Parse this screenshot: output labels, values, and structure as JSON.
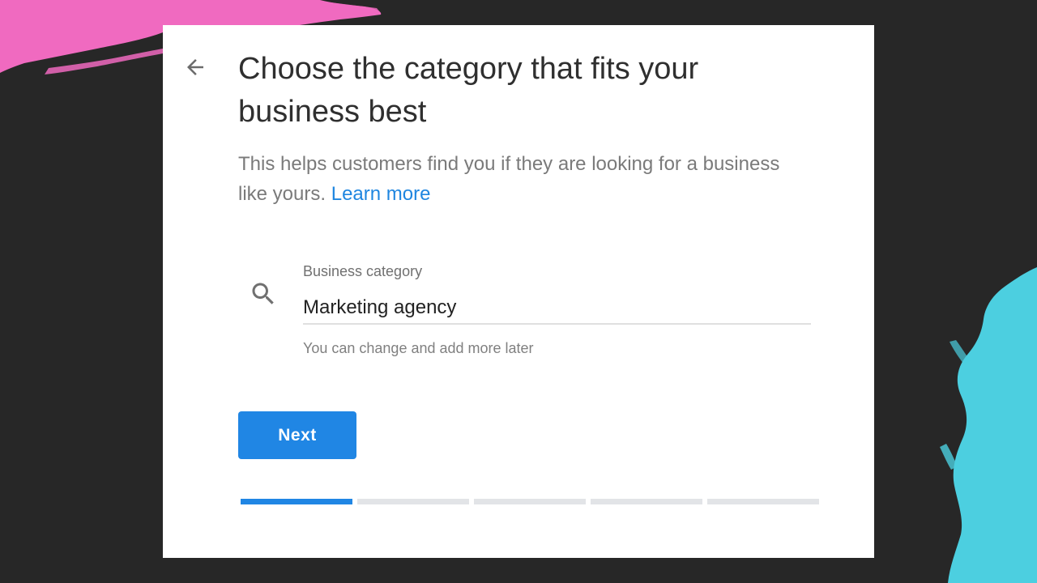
{
  "page": {
    "title": "Choose the category that fits your business best",
    "subtitle": "This helps customers find you if they are looking for a business like yours.",
    "learn_more_label": "Learn more"
  },
  "back_icon": "arrow-back-icon",
  "category_field": {
    "label": "Business category",
    "value": "Marketing agency",
    "helper": "You can change and add more later",
    "icon": "search-icon"
  },
  "next_button": {
    "label": "Next"
  },
  "progress": {
    "total_steps": 5,
    "current_step": 1
  },
  "colors": {
    "accent": "#2086e4",
    "link": "#1f86e0",
    "background": "#272727",
    "brush_pink": "#f06ac0",
    "brush_cyan": "#4ccfe0"
  }
}
